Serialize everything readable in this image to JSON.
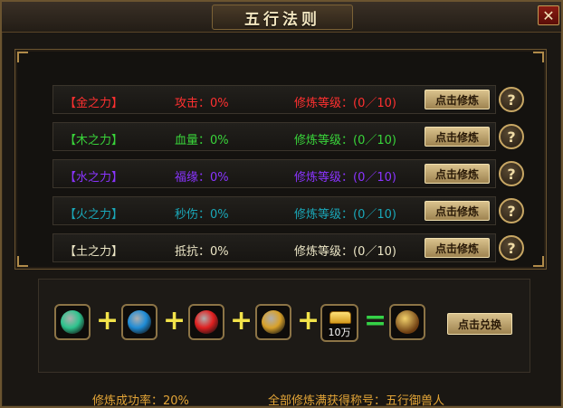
{
  "window": {
    "title": "五行法则",
    "close_label": "✕"
  },
  "rows": [
    {
      "element": "【金之力】",
      "stat": "攻击：0%",
      "level": "修炼等级：(0／10)",
      "button": "点击修炼",
      "help": "?",
      "color": "#ff3030"
    },
    {
      "element": "【木之力】",
      "stat": "血量：0%",
      "level": "修炼等级：(0／10)",
      "button": "点击修炼",
      "help": "?",
      "color": "#39d43a"
    },
    {
      "element": "【水之力】",
      "stat": "福缘：0%",
      "level": "修炼等级：(0／10)",
      "button": "点击修炼",
      "help": "?",
      "color": "#8a34ff"
    },
    {
      "element": "【火之力】",
      "stat": "秒伤：0%",
      "level": "修炼等级：(0／10)",
      "button": "点击修炼",
      "help": "?",
      "color": "#1aa7b8"
    },
    {
      "element": "【土之力】",
      "stat": "抵抗：0%",
      "level": "修炼等级：(0／10)",
      "button": "点击修炼",
      "help": "?",
      "color": "#ece6c6"
    }
  ],
  "combine": {
    "orbs": [
      {
        "name": "green-orb-icon",
        "color": "#2ec48e"
      },
      {
        "name": "blue-orb-icon",
        "color": "#1f8cd6"
      },
      {
        "name": "red-orb-icon",
        "color": "#e02020"
      },
      {
        "name": "gold-orb-icon",
        "color": "#d8a12a"
      }
    ],
    "gold_amount": "10万",
    "result_icon": "beast-orb-icon",
    "exchange_button": "点击兑换"
  },
  "footer": {
    "success_rate": "修炼成功率：20%",
    "title_reward": "全部修炼满获得称号：五行御兽人"
  }
}
